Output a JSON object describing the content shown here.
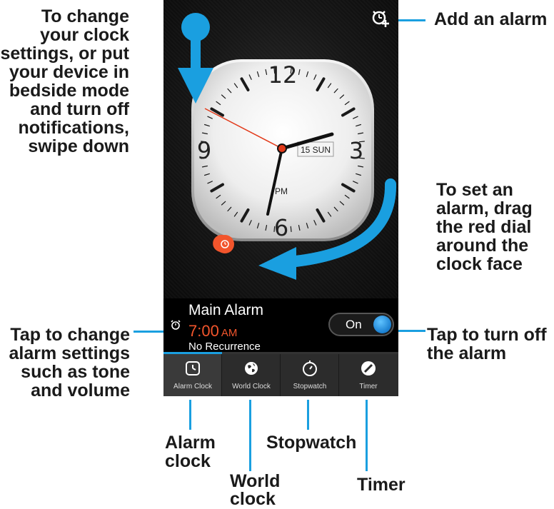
{
  "callouts": {
    "settings": [
      "To change",
      "your clock",
      "settings, or put",
      "your device in",
      "bedside mode",
      "and turn off",
      "notifications,",
      "swipe down"
    ],
    "add_alarm": "Add an alarm",
    "set_alarm": [
      "To set an",
      "alarm, drag",
      "the red dial",
      "around the",
      "clock face"
    ],
    "alarm_settings": [
      "Tap to change",
      "alarm settings",
      "such as tone",
      "and volume"
    ],
    "turn_off": [
      "Tap to turn off",
      "the alarm"
    ],
    "tab_alarm": [
      "Alarm",
      "clock"
    ],
    "tab_world": [
      "World",
      "clock"
    ],
    "tab_stopwatch": "Stopwatch",
    "tab_timer": "Timer"
  },
  "clock": {
    "numerals": [
      "12",
      "3",
      "6",
      "9"
    ],
    "date": "15 SUN",
    "period": "PM"
  },
  "alarm": {
    "name": "Main Alarm",
    "time": "7:00",
    "ampm": "AM",
    "recurrence": "No Recurrence",
    "toggle_label": "On"
  },
  "tabs": [
    {
      "label": "Alarm Clock",
      "icon": "alarm-clock-icon",
      "active": true
    },
    {
      "label": "World Clock",
      "icon": "globe-icon",
      "active": false
    },
    {
      "label": "Stopwatch",
      "icon": "stopwatch-icon",
      "active": false
    },
    {
      "label": "Timer",
      "icon": "timer-icon",
      "active": false
    }
  ],
  "colors": {
    "accent_blue": "#1a9fe0",
    "alarm_red": "#f2552c"
  }
}
